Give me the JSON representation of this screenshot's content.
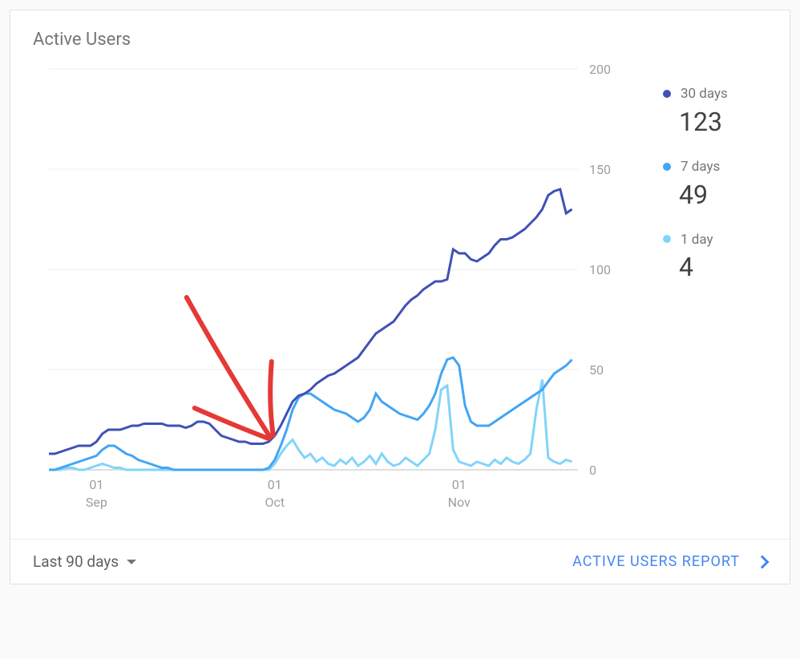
{
  "title": "Active Users",
  "footer": {
    "range_label": "Last 90 days",
    "report_label": "ACTIVE USERS REPORT"
  },
  "legend": [
    {
      "color": "#3f51b5",
      "label": "30 days",
      "value": "123"
    },
    {
      "color": "#42a5f5",
      "label": "7 days",
      "value": "49"
    },
    {
      "color": "#81d4fa",
      "label": "1 day",
      "value": "4"
    }
  ],
  "chart_data": {
    "type": "line",
    "title": "Active Users",
    "xlabel": "",
    "ylabel": "",
    "ylim": [
      0,
      200
    ],
    "y_ticks": [
      0,
      50,
      100,
      150,
      200
    ],
    "x_tick_labels": [
      {
        "t": 8,
        "top": "01",
        "bottom": "Sep"
      },
      {
        "t": 38,
        "top": "01",
        "bottom": "Oct"
      },
      {
        "t": 69,
        "top": "01",
        "bottom": "Nov"
      }
    ],
    "x_range": [
      0,
      89
    ],
    "series": [
      {
        "name": "30 days",
        "color": "#3f51b5",
        "values": [
          8,
          8,
          9,
          10,
          11,
          12,
          12,
          12,
          14,
          18,
          20,
          20,
          20,
          21,
          22,
          22,
          23,
          23,
          23,
          23,
          22,
          22,
          22,
          21,
          22,
          24,
          24,
          23,
          20,
          17,
          16,
          15,
          14,
          14,
          13,
          13,
          13,
          14,
          17,
          22,
          28,
          34,
          37,
          38,
          40,
          43,
          45,
          47,
          48,
          50,
          52,
          54,
          56,
          60,
          64,
          68,
          70,
          72,
          74,
          78,
          82,
          85,
          87,
          90,
          92,
          94,
          94,
          95,
          110,
          108,
          108,
          105,
          104,
          106,
          108,
          112,
          115,
          115,
          116,
          118,
          120,
          123,
          126,
          130,
          137,
          139,
          140,
          128,
          130
        ]
      },
      {
        "name": "7 days",
        "color": "#42a5f5",
        "values": [
          0,
          0,
          1,
          2,
          3,
          4,
          5,
          6,
          7,
          10,
          12,
          12,
          10,
          8,
          7,
          5,
          4,
          3,
          2,
          1,
          1,
          0,
          0,
          0,
          0,
          0,
          0,
          0,
          0,
          0,
          0,
          0,
          0,
          0,
          0,
          0,
          0,
          1,
          5,
          12,
          20,
          30,
          36,
          38,
          38,
          36,
          34,
          32,
          30,
          29,
          28,
          26,
          24,
          26,
          30,
          38,
          34,
          32,
          30,
          28,
          27,
          26,
          25,
          28,
          32,
          38,
          48,
          55,
          56,
          52,
          32,
          24,
          22,
          22,
          22,
          24,
          26,
          28,
          30,
          32,
          34,
          36,
          38,
          40,
          44,
          48,
          50,
          52,
          55
        ]
      },
      {
        "name": "1 day",
        "color": "#81d4fa",
        "values": [
          0,
          0,
          0,
          1,
          1,
          0,
          0,
          1,
          2,
          3,
          2,
          1,
          1,
          0,
          0,
          0,
          0,
          0,
          0,
          0,
          0,
          0,
          0,
          0,
          0,
          0,
          0,
          0,
          0,
          0,
          0,
          0,
          0,
          0,
          0,
          0,
          0,
          0,
          3,
          8,
          12,
          15,
          10,
          6,
          8,
          4,
          6,
          3,
          2,
          5,
          3,
          6,
          2,
          4,
          7,
          3,
          8,
          4,
          2,
          3,
          6,
          4,
          2,
          5,
          8,
          20,
          40,
          42,
          10,
          4,
          3,
          2,
          4,
          3,
          2,
          5,
          3,
          6,
          4,
          3,
          5,
          8,
          30,
          45,
          6,
          4,
          3,
          5,
          4
        ]
      }
    ],
    "annotation": {
      "type": "arrow",
      "points_to_t": 38,
      "note": "hand-drawn red arrow"
    }
  }
}
